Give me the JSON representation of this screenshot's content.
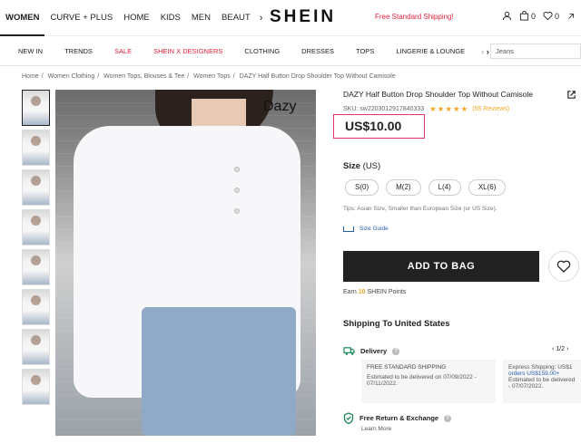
{
  "header": {
    "nav": [
      "WOMEN",
      "CURVE + PLUS",
      "HOME",
      "KIDS",
      "MEN",
      "BEAUT"
    ],
    "logo": "SHEIN",
    "promo": "Free Standard Shipping!",
    "bag_count": "0",
    "wish_count": "0"
  },
  "categories": {
    "items": [
      "NEW IN",
      "TRENDS",
      "SALE",
      "SHEIN X DESIGNERS",
      "CLOTHING",
      "DRESSES",
      "TOPS",
      "LINGERIE & LOUNGE"
    ],
    "search_value": "Jeans"
  },
  "breadcrumb": [
    "Home",
    "Women Clothing",
    "Women Tops, Blouses & Tee",
    "Women Tops",
    "DAZY Half Button Drop Shoulder Top Without Camisole"
  ],
  "gallery": {
    "watermark": "Dazy"
  },
  "product": {
    "title": "DAZY Half Button Drop Shoulder Top Without Camisole",
    "sku": "SKU: sw2203012917840333",
    "stars": "★★★★★",
    "reviews": "(55 Reviews)",
    "price": "US$10.00",
    "size_label": "Size",
    "size_unit": "(US)",
    "sizes": [
      "S(0)",
      "M(2)",
      "L(4)",
      "XL(6)"
    ],
    "tips": "Tips: Asian Size, Smaller than European Size (or US Size).",
    "size_guide": "Size Guide",
    "add_to_bag": "ADD TO BAG",
    "points_prefix": "Earn",
    "points_value": "10",
    "points_suffix": "SHEIN Points"
  },
  "shipping": {
    "heading": "Shipping To United States",
    "delivery_label": "Delivery",
    "pager": "1/2",
    "standard_title": "FREE STANDARD SHIPPING",
    "standard_est": "Estimated to be delivered on 07/09/2022 - 07/11/2022.",
    "express_title": "Express Shipping: US$1",
    "express_line2": "orders US$159.00+",
    "express_line3": "Estimated to be delivered",
    "express_line4": "- 07/07/2022.",
    "returns_label": "Free Return & Exchange",
    "learn_more": "Learn More"
  }
}
